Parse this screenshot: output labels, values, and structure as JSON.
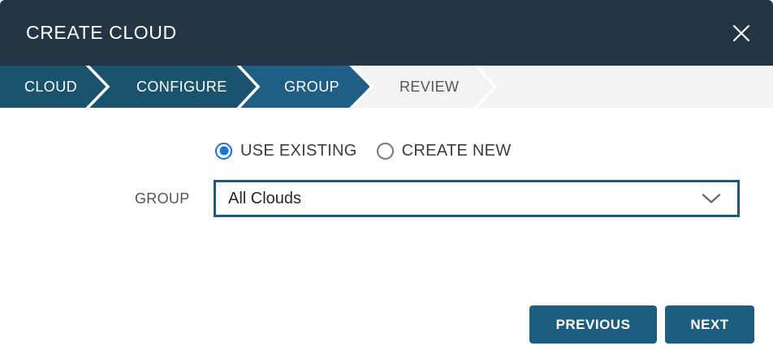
{
  "dialog": {
    "title": "CREATE CLOUD"
  },
  "icons": {
    "close": "✕",
    "select_caret": "⌄",
    "step_separator": "›"
  },
  "steps": {
    "items": [
      {
        "label": "CLOUD",
        "state": "completed"
      },
      {
        "label": "CONFIGURE",
        "state": "completed"
      },
      {
        "label": "GROUP",
        "state": "active"
      },
      {
        "label": "REVIEW",
        "state": "upcoming"
      }
    ]
  },
  "form": {
    "group_mode": {
      "options": [
        {
          "label": "USE EXISTING",
          "selected": true
        },
        {
          "label": "CREATE NEW",
          "selected": false
        }
      ]
    },
    "group_field": {
      "label": "GROUP",
      "value": "All Clouds"
    }
  },
  "footer": {
    "previous_label": "PREVIOUS",
    "next_label": "NEXT"
  },
  "colors": {
    "header_bg": "#243546",
    "step_completed_bg": "#1A536E",
    "step_active_bg": "#1F5F86",
    "step_bar_bg": "#F2F3F5",
    "step_upcoming_text": "#555555",
    "button_bg": "#1D5D80",
    "radio_selected": "#1774D8",
    "dropdown_border": "#1D5A78"
  }
}
